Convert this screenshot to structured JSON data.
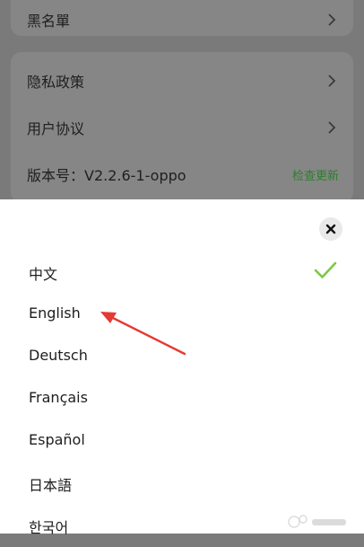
{
  "settings": {
    "blacklist_label": "黑名單",
    "privacy_label": "隐私政策",
    "agreement_label": "用户协议",
    "version_label": "版本号：V2.2.6-1-oppo",
    "check_update_label": "检查更新"
  },
  "language_sheet": {
    "options": [
      {
        "label": "中文",
        "selected": true
      },
      {
        "label": "English",
        "selected": false
      },
      {
        "label": "Deutsch",
        "selected": false
      },
      {
        "label": "Français",
        "selected": false
      },
      {
        "label": "Español",
        "selected": false
      },
      {
        "label": "日本語",
        "selected": false
      },
      {
        "label": "한국어",
        "selected": false
      }
    ]
  },
  "colors": {
    "accent": "#7ac943",
    "annotation": "#e53935"
  }
}
